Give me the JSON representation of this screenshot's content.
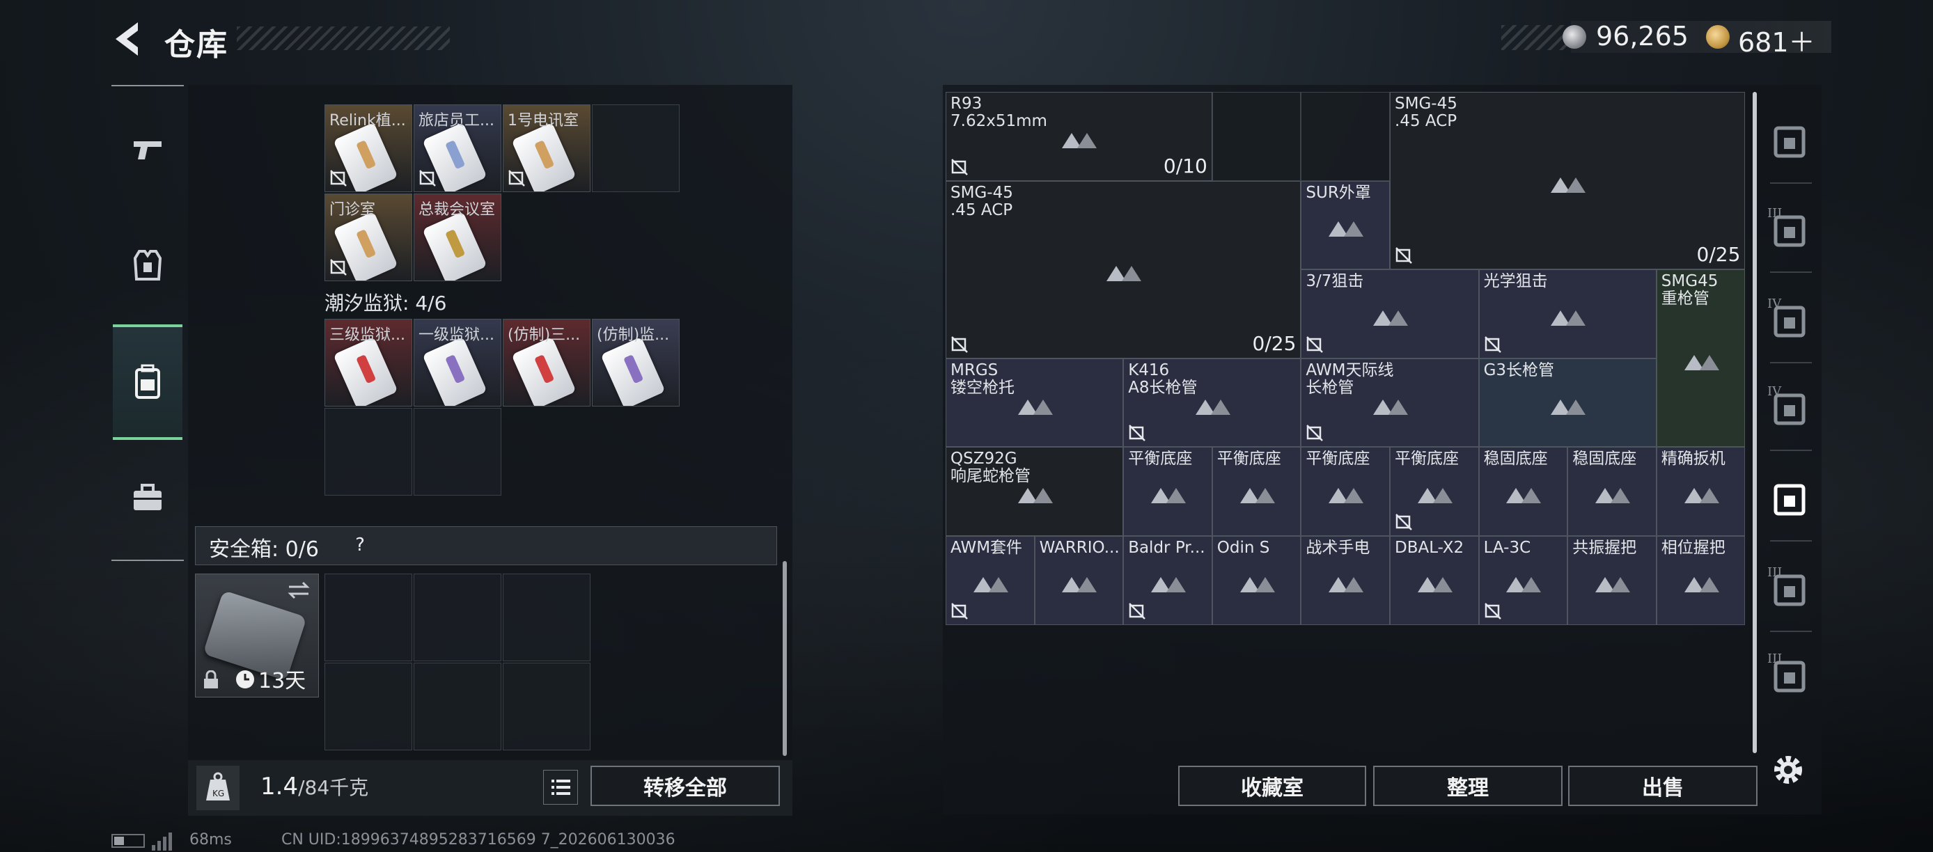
{
  "header": {
    "title": "仓库",
    "currency": [
      {
        "icon": "silver-coin-icon",
        "value": "96,265"
      },
      {
        "icon": "gold-coin-icon",
        "value": "681＋"
      }
    ]
  },
  "left_tabs": [
    {
      "icon": "pistol-icon"
    },
    {
      "icon": "vest-icon"
    },
    {
      "icon": "backpack-icon",
      "active": true
    },
    {
      "icon": "briefcase-icon"
    }
  ],
  "containers": {
    "section1_items": [
      {
        "label": "Relink植...",
        "tag": "#d0a060",
        "bg": "#5a4a32"
      },
      {
        "label": "旅店员工...",
        "tag": "#8aa0d0",
        "bg": "#34394e"
      },
      {
        "label": "1号电讯室",
        "tag": "#d0a060",
        "bg": "#5a4a32"
      },
      {
        "label": "门诊室",
        "tag": "#d0a060",
        "bg": "#5a4a32"
      },
      {
        "label": "总裁会议室",
        "tag": "#c09a40",
        "bg": "#5e2a2e"
      }
    ],
    "section2_title": "潮汐监狱: 4/6",
    "section2_items": [
      {
        "label": "三级监狱...",
        "tag": "#d04040",
        "bg": "#5e2a2e"
      },
      {
        "label": "一级监狱...",
        "tag": "#8a70c0",
        "bg": "#34394e"
      },
      {
        "label": "(仿制)三...",
        "tag": "#d04040",
        "bg": "#5e2a2e"
      },
      {
        "label": "(仿制)监...",
        "tag": "#8a70c0",
        "bg": "#3a3d52"
      }
    ]
  },
  "safe": {
    "label": "安全箱: 0/6",
    "help": "?",
    "duration": "13天"
  },
  "weight": {
    "current": "1.4",
    "max": "/84千克"
  },
  "buttons": {
    "transfer_all": "转移全部",
    "collection": "收藏室",
    "organize": "整理",
    "sell": "出售"
  },
  "stash_items": [
    {
      "name": "R93\n7.62x51mm",
      "c": 0,
      "r": 0,
      "w": 3,
      "h": 1,
      "count": "0/10",
      "nocol": true,
      "bg": "#1e2227"
    },
    {
      "name": "SMG-45\n.45 ACP",
      "c": 5,
      "r": 0,
      "w": 4,
      "h": 2,
      "count": "0/25",
      "nocol": true,
      "bg": "#1e2227"
    },
    {
      "name": "SMG-45\n.45 ACP",
      "c": 0,
      "r": 1,
      "w": 4,
      "h": 2,
      "count": "0/25",
      "nocol": true,
      "bg": "#1e2227"
    },
    {
      "name": "SUR外罩",
      "c": 4,
      "r": 1,
      "w": 1,
      "h": 1,
      "bg": "#2a2e40"
    },
    {
      "name": "3/7狙击",
      "c": 4,
      "r": 2,
      "w": 2,
      "h": 1,
      "nocol": true,
      "bg": "#2a2e40"
    },
    {
      "name": "光学狙击",
      "c": 6,
      "r": 2,
      "w": 2,
      "h": 1,
      "nocol": true,
      "bg": "#2a2e40"
    },
    {
      "name": "SMG45\n重枪管",
      "c": 8,
      "r": 2,
      "w": 1,
      "h": 2,
      "bg": "#26342c"
    },
    {
      "name": "MRGS\n镂空枪托",
      "c": 0,
      "r": 3,
      "w": 2,
      "h": 1,
      "bg": "#2a2e40"
    },
    {
      "name": "K416\nA8长枪管",
      "c": 2,
      "r": 3,
      "w": 2,
      "h": 1,
      "nocol": true,
      "bg": "#2a2e40"
    },
    {
      "name": "AWM天际线\n长枪管",
      "c": 4,
      "r": 3,
      "w": 2,
      "h": 1,
      "nocol": true,
      "bg": "#2a2e40"
    },
    {
      "name": "G3长枪管",
      "c": 6,
      "r": 3,
      "w": 2,
      "h": 1,
      "bg": "#2a3646"
    },
    {
      "name": "QSZ92G\n响尾蛇枪管",
      "c": 0,
      "r": 4,
      "w": 2,
      "h": 1,
      "bg": "#1e2227"
    },
    {
      "name": "平衡底座",
      "c": 2,
      "r": 4,
      "w": 1,
      "h": 1,
      "bg": "#2a2e40"
    },
    {
      "name": "平衡底座",
      "c": 3,
      "r": 4,
      "w": 1,
      "h": 1,
      "bg": "#2a2e40"
    },
    {
      "name": "平衡底座",
      "c": 4,
      "r": 4,
      "w": 1,
      "h": 1,
      "bg": "#2a2e40"
    },
    {
      "name": "平衡底座",
      "c": 5,
      "r": 4,
      "w": 1,
      "h": 1,
      "nocol": true,
      "bg": "#2a2e40"
    },
    {
      "name": "稳固底座",
      "c": 6,
      "r": 4,
      "w": 1,
      "h": 1,
      "bg": "#2a2e40"
    },
    {
      "name": "稳固底座",
      "c": 7,
      "r": 4,
      "w": 1,
      "h": 1,
      "bg": "#2a2e40"
    },
    {
      "name": "精确扳机",
      "c": 8,
      "r": 4,
      "w": 1,
      "h": 1,
      "bg": "#2a2e40"
    },
    {
      "name": "AWM套件",
      "c": 0,
      "r": 5,
      "w": 1,
      "h": 1,
      "nocol": true,
      "bg": "#2a2e40"
    },
    {
      "name": "WARRIO...",
      "c": 1,
      "r": 5,
      "w": 1,
      "h": 1,
      "bg": "#2a2e40"
    },
    {
      "name": "Baldr Pr...",
      "c": 2,
      "r": 5,
      "w": 1,
      "h": 1,
      "nocol": true,
      "bg": "#2a2e40"
    },
    {
      "name": "Odin S",
      "c": 3,
      "r": 5,
      "w": 1,
      "h": 1,
      "bg": "#2a2e40"
    },
    {
      "name": "战术手电",
      "c": 4,
      "r": 5,
      "w": 1,
      "h": 1,
      "bg": "#2a2e40"
    },
    {
      "name": "DBAL-X2",
      "c": 5,
      "r": 5,
      "w": 1,
      "h": 1,
      "bg": "#2a2e40"
    },
    {
      "name": "LA-3C",
      "c": 6,
      "r": 5,
      "w": 1,
      "h": 1,
      "nocol": true,
      "bg": "#2a2e40"
    },
    {
      "name": "共振握把",
      "c": 7,
      "r": 5,
      "w": 1,
      "h": 1,
      "bg": "#2a2e40"
    },
    {
      "name": "相位握把",
      "c": 8,
      "r": 5,
      "w": 1,
      "h": 1,
      "bg": "#2a2e40"
    }
  ],
  "right_tabs": [
    {
      "icon": "helmet-icon",
      "level": ""
    },
    {
      "icon": "armor-level3-icon",
      "level": "III"
    },
    {
      "icon": "bag-level4-icon",
      "level": "IV"
    },
    {
      "icon": "medkit-level4-icon",
      "level": "IV"
    },
    {
      "icon": "gun-mods-icon",
      "level": "",
      "active": true
    },
    {
      "icon": "armor-level3-icon-2",
      "level": "III"
    },
    {
      "icon": "armor-level3-icon-3",
      "level": "III"
    }
  ],
  "footer": {
    "ping": "68ms",
    "uid": "CN UID:18996374895283716569 7_202606130036"
  }
}
